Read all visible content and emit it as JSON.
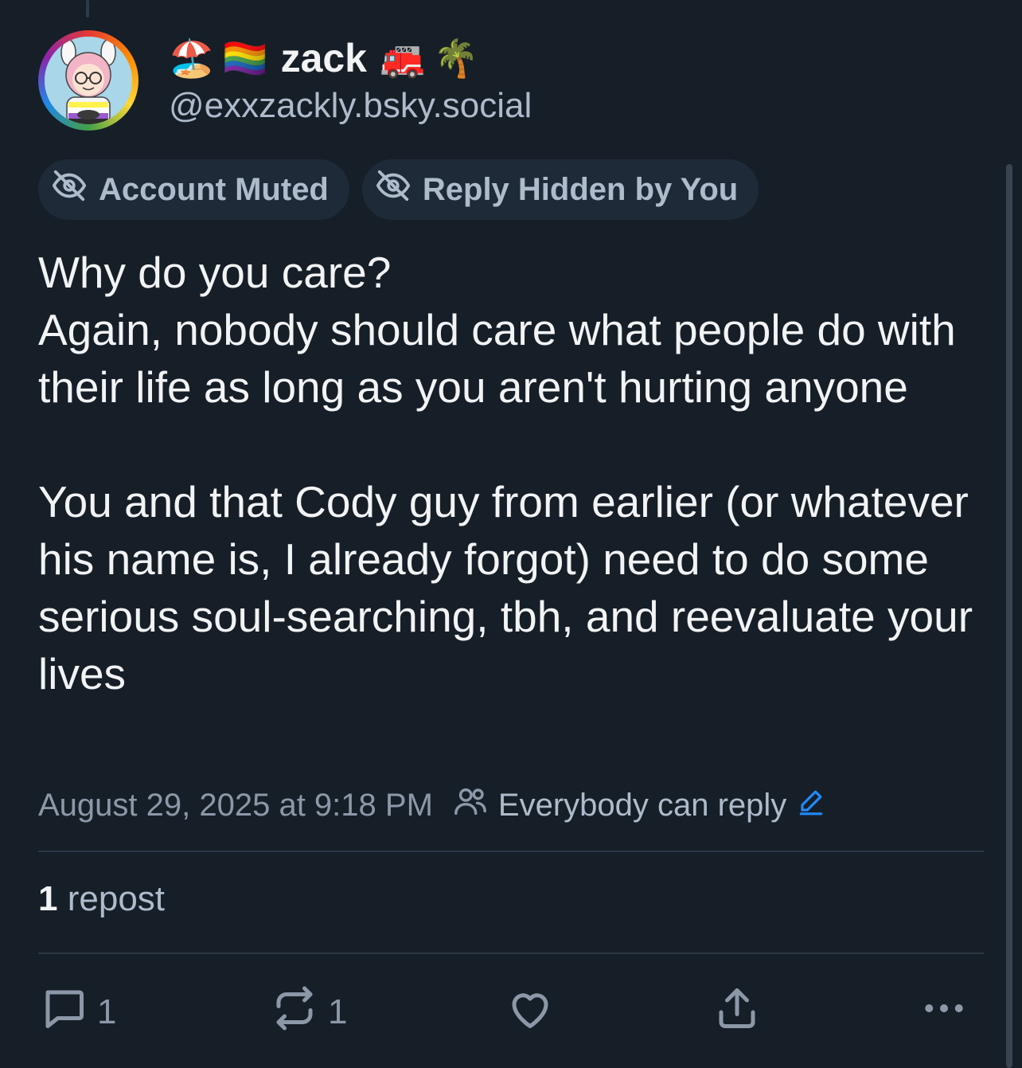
{
  "author": {
    "display_name": "zack",
    "emoji_before": [
      "🏖️",
      "🏳️‍🌈"
    ],
    "emoji_after": [
      "🚒",
      "🌴"
    ],
    "handle": "@exxzackly.bsky.social"
  },
  "labels": [
    {
      "text": "Account Muted",
      "icon": "eye-slash-icon"
    },
    {
      "text": "Reply Hidden by You",
      "icon": "eye-slash-icon"
    }
  ],
  "post": {
    "text": "Why do you care?\nAgain, nobody should care what people do with their life as long as you aren't hurting anyone\n\nYou and that Cody guy from earlier (or whatever his name is, I already forgot) need to do some serious soul-searching, tbh, and reevaluate your lives",
    "timestamp": "August 29, 2025 at 9:18 PM",
    "reply_setting": "Everybody can reply"
  },
  "stats": {
    "repost_count": "1",
    "repost_label": "repost"
  },
  "actions": {
    "reply_count": "1",
    "repost_count": "1"
  },
  "colors": {
    "background": "#161e27",
    "text_primary": "#f1f3f5",
    "text_secondary": "#aebbcb",
    "accent": "#208bfe",
    "pill_background": "#1e2a38"
  }
}
